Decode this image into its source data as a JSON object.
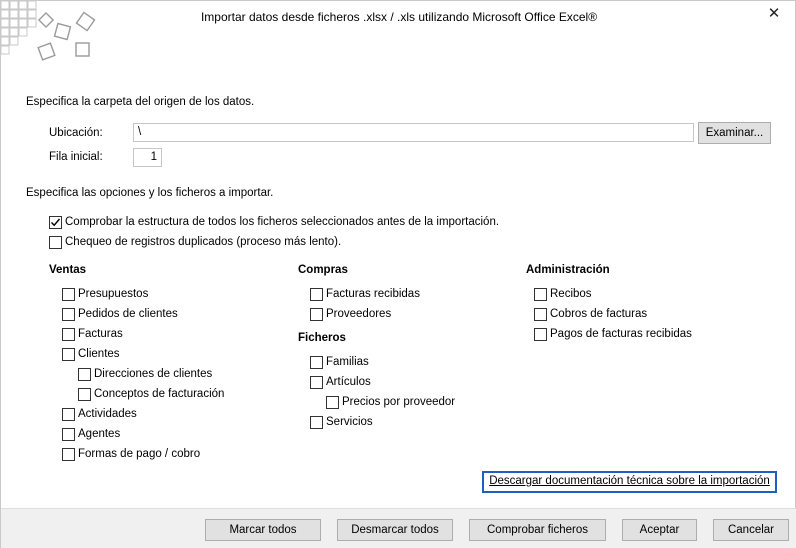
{
  "window": {
    "title": "Importar datos desde ficheros .xlsx / .xls utilizando Microsoft Office Excel®",
    "close_glyph": "✕"
  },
  "origin": {
    "section_title": "Especifica la carpeta del origen de los datos.",
    "location_label": "Ubicación:",
    "location_value": "\\",
    "browse_label": "Examinar...",
    "start_row_label": "Fila inicial:",
    "start_row_value": "1"
  },
  "options": {
    "section_title": "Especifica las opciones y los ficheros a importar.",
    "check_structure": {
      "label": "Comprobar la estructura de todos los ficheros seleccionados antes de la importación.",
      "checked": true
    },
    "check_duplicates": {
      "label": "Chequeo de registros duplicados (proceso más lento).",
      "checked": false
    }
  },
  "groups": {
    "ventas": {
      "title": "Ventas",
      "items": [
        {
          "label": "Presupuestos",
          "checked": false
        },
        {
          "label": "Pedidos de clientes",
          "checked": false
        },
        {
          "label": "Facturas",
          "checked": false
        },
        {
          "label": "Clientes",
          "checked": false
        },
        {
          "label": "Direcciones de clientes",
          "checked": false
        },
        {
          "label": "Conceptos de facturación",
          "checked": false
        },
        {
          "label": "Actividades",
          "checked": false
        },
        {
          "label": "Agentes",
          "checked": false
        },
        {
          "label": "Formas de pago / cobro",
          "checked": false
        }
      ]
    },
    "compras": {
      "title": "Compras",
      "items": [
        {
          "label": "Facturas recibidas",
          "checked": false
        },
        {
          "label": "Proveedores",
          "checked": false
        }
      ]
    },
    "ficheros": {
      "title": "Ficheros",
      "items": [
        {
          "label": "Familias",
          "checked": false
        },
        {
          "label": "Artículos",
          "checked": false
        },
        {
          "label": "Precios por proveedor",
          "checked": false
        },
        {
          "label": "Servicios",
          "checked": false
        }
      ]
    },
    "administracion": {
      "title": "Administración",
      "items": [
        {
          "label": "Recibos",
          "checked": false
        },
        {
          "label": "Cobros de facturas",
          "checked": false
        },
        {
          "label": "Pagos de facturas recibidas",
          "checked": false
        }
      ]
    }
  },
  "doc_link": "Descargar documentación técnica sobre la importación",
  "footer": {
    "mark_all": "Marcar todos",
    "unmark_all": "Desmarcar todos",
    "check_files": "Comprobar ficheros",
    "accept": "Aceptar",
    "cancel": "Cancelar"
  },
  "colors": {
    "focus_border": "#0078d7",
    "link_border": "#1f5fbf",
    "footer_bg": "#f0f0f0"
  }
}
